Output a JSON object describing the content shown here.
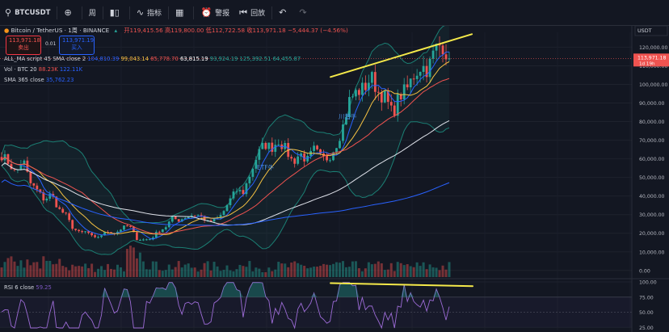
{
  "toolbar": {
    "symbol": "BTCUSDT",
    "interval": "周",
    "indicators": "指标",
    "alert": "警报",
    "replay": "回放",
    "icons": [
      "search-icon",
      "add-icon",
      "bar-style-icon",
      "indicators-icon",
      "layouts-icon",
      "alert-icon",
      "replay-icon",
      "undo-icon",
      "redo-icon"
    ]
  },
  "header": {
    "title": "Bitcoin / TetherUS · 1周 · BINANCE",
    "open_label": "开",
    "open": "119,415.56",
    "high_label": "高",
    "high": "119,800.00",
    "low_label": "低",
    "low": "112,722.58",
    "close_label": "收",
    "close": "113,971.18",
    "change": "−5,444.37 (−4.56%)",
    "sell_price": "113,971.18",
    "sell_label": "卖出",
    "spread": "0.01",
    "buy_price": "113,971.19",
    "buy_label": "买入"
  },
  "legends": {
    "ma_script": {
      "name": "ALL_MA script 45 SMA close 2",
      "values": [
        "104,810.39",
        "99,043.14",
        "85,778.70",
        "63,815.19",
        "93,924.19",
        "125,392.51",
        "64,455.87"
      ]
    },
    "vol": {
      "name": "Vol · BTC 20",
      "values": [
        "88.23K",
        "122.11K"
      ]
    },
    "sma365": {
      "name": "SMA 365 close",
      "value": "35,762.23"
    },
    "rsi": {
      "name": "RSI 6 close",
      "value": "59.25"
    }
  },
  "annotations": {
    "etf": "ETF牛",
    "trump": "川普牛"
  },
  "colors": {
    "up": "#26a69a",
    "down": "#ef5350",
    "trend": "#f5e94a",
    "bg": "#131722"
  },
  "chart_data": [
    {
      "type": "candlestick",
      "title": "Bitcoin / TetherUS · 1周 · BINANCE",
      "currency": "USDT",
      "y_ticks": [
        "120,000.00",
        "110,000.00",
        "100,000.00",
        "90,000.00",
        "80,000.00",
        "70,000.00",
        "60,000.00",
        "50,000.00",
        "40,000.00",
        "30,000.00",
        "20,000.00",
        "10,000.00",
        "0.00"
      ],
      "ylim": [
        -4000,
        128000
      ],
      "last_price": "113,971.18",
      "countdown": "1d 19h",
      "close_path": [
        62000,
        58000,
        52000,
        60000,
        47000,
        43000,
        38000,
        41000,
        33000,
        30000,
        23000,
        20000,
        21000,
        17000,
        19000,
        21000,
        20000,
        23000,
        24000,
        17000,
        16500,
        17000,
        21000,
        23000,
        28000,
        27000,
        29000,
        30000,
        29500,
        26000,
        27000,
        30000,
        37000,
        43000,
        42000,
        52000,
        62000,
        68000,
        66000,
        70000,
        65000,
        58000,
        63000,
        59000,
        65000,
        60000,
        60500,
        67000,
        77000,
        92000,
        96000,
        98000,
        104000,
        96000,
        93000,
        84000,
        94000,
        97000,
        105000,
        110000,
        108000,
        119000,
        122000,
        113971
      ],
      "trend_lines": [
        {
          "series": "price",
          "from_index": 48,
          "from_value": 104000,
          "to_index": 63,
          "to_value": 127000
        },
        {
          "series": "rsi",
          "from_index": 48,
          "from_value": 98,
          "to_index": 63,
          "to_value": 93
        }
      ]
    },
    {
      "type": "line",
      "title": "RSI 6 close",
      "y_ticks": [
        "100.00",
        "75.00",
        "50.00",
        "25.00"
      ],
      "ylim": [
        20,
        104
      ]
    }
  ]
}
